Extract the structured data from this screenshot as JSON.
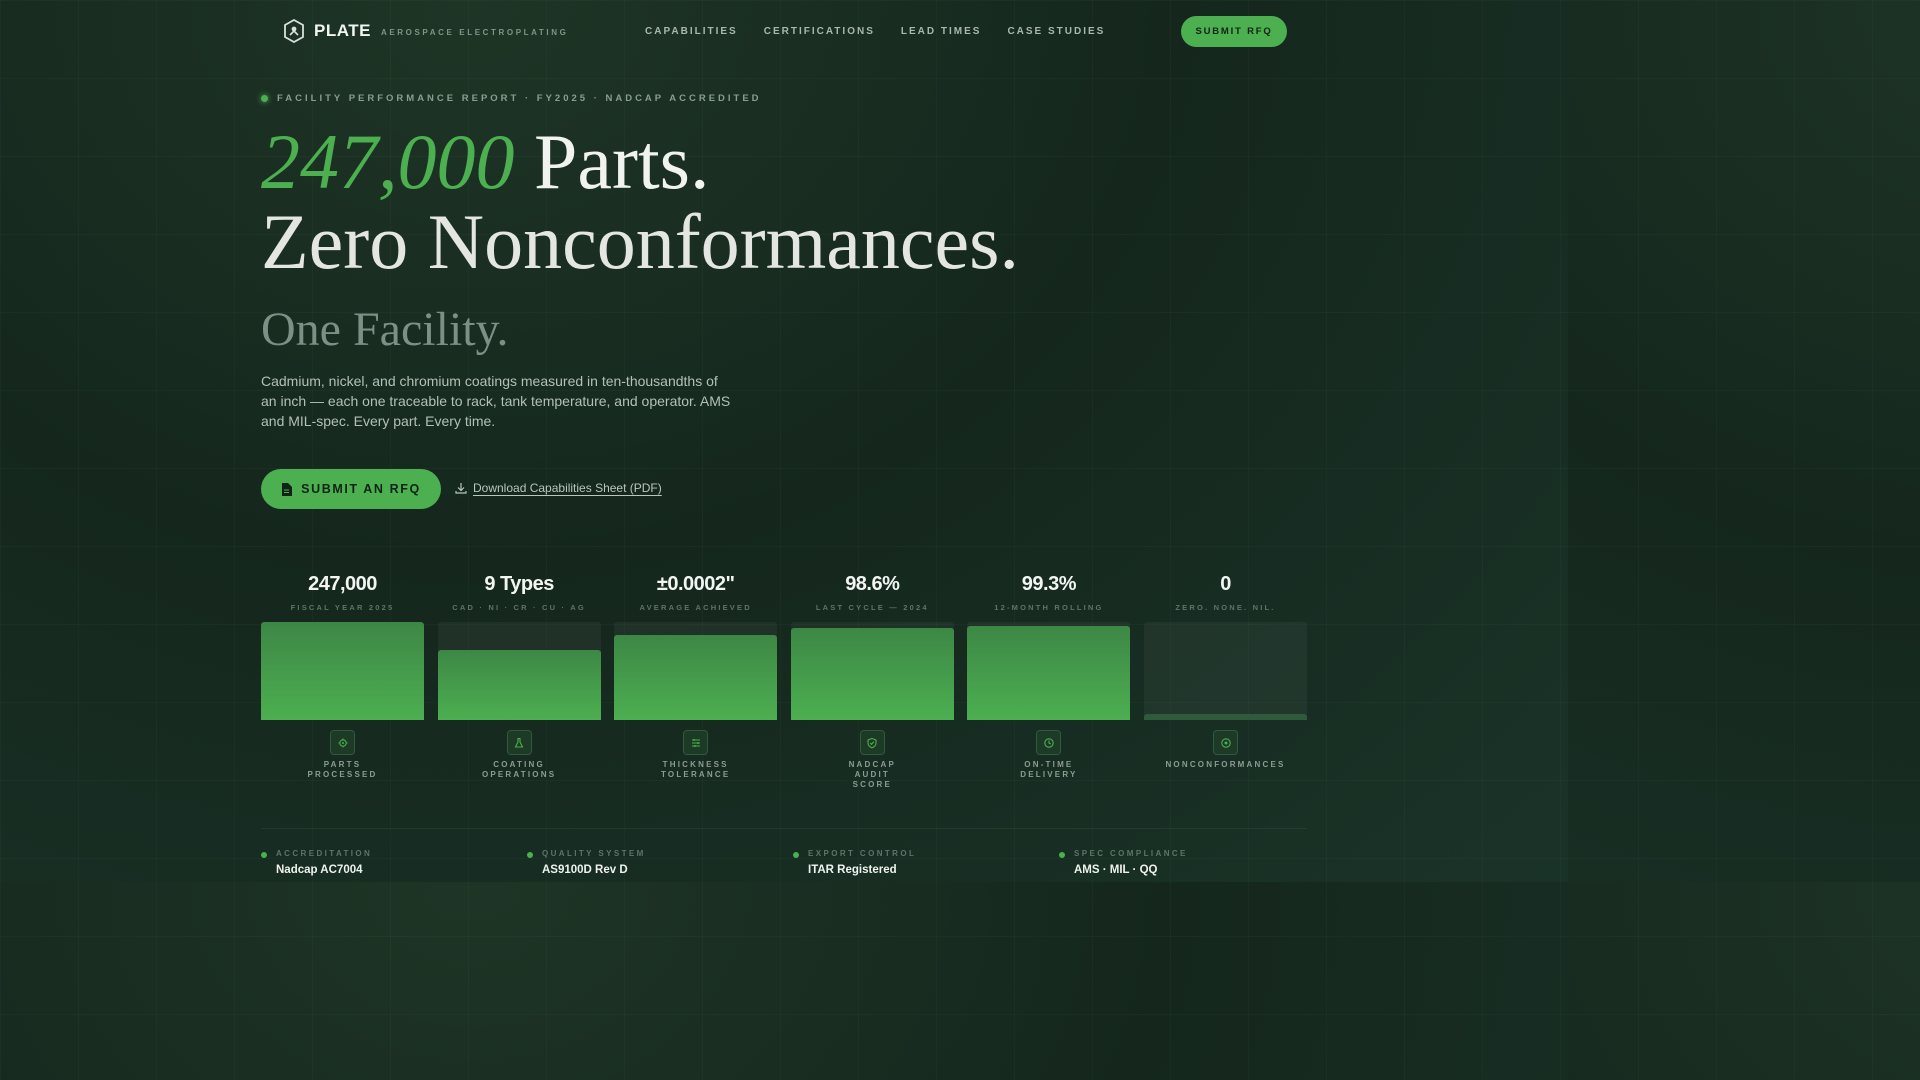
{
  "nav": {
    "brand": "PLATE",
    "tagline": "AEROSPACE ELECTROPLATING",
    "links": [
      "CAPABILITIES",
      "CERTIFICATIONS",
      "LEAD TIMES",
      "CASE STUDIES"
    ],
    "cta": "SUBMIT RFQ"
  },
  "hero": {
    "eyebrow": "FACILITY PERFORMANCE REPORT · FY2025 · NADCAP ACCREDITED",
    "headline_accent": "247,000",
    "headline_rest": " Parts.",
    "headline_line2": "Zero Nonconformances.",
    "subheadline": "One Facility.",
    "lede": "Cadmium, nickel, and chromium coatings measured in ten-thousandths of an inch — each one traceable to rack, tank temperature, and operator. AMS and MIL-spec. Every part. Every time.",
    "cta_primary": "SUBMIT AN RFQ",
    "cta_secondary": "Download Capabilities Sheet (PDF)"
  },
  "stats": [
    {
      "value": "247,000",
      "caption": "FISCAL YEAR 2025",
      "fill": 1.0,
      "icon": "gear-icon",
      "label": [
        "PARTS",
        "PROCESSED"
      ]
    },
    {
      "value": "9 Types",
      "caption": "CAD · NI · CR · CU · AG",
      "fill": 0.71,
      "icon": "flask-icon",
      "label": [
        "COATING",
        "OPERATIONS"
      ]
    },
    {
      "value": "±0.0002\"",
      "caption": "AVERAGE ACHIEVED",
      "fill": 0.87,
      "icon": "sliders-icon",
      "label": [
        "THICKNESS",
        "TOLERANCE"
      ]
    },
    {
      "value": "98.6%",
      "caption": "LAST CYCLE — 2024",
      "fill": 0.94,
      "icon": "shield-check-icon",
      "label": [
        "NADCAP",
        "AUDIT",
        "SCORE"
      ]
    },
    {
      "value": "99.3%",
      "caption": "12-MONTH ROLLING",
      "fill": 0.96,
      "icon": "clock-icon",
      "label": [
        "ON-TIME",
        "DELIVERY"
      ]
    },
    {
      "value": "0",
      "caption": "ZERO. NONE. NIL.",
      "fill": 0.06,
      "icon": "target-icon",
      "label": [
        "NONCONFORMANCES"
      ]
    }
  ],
  "facts": [
    {
      "label": "ACCREDITATION",
      "value": "Nadcap AC7004"
    },
    {
      "label": "QUALITY SYSTEM",
      "value": "AS9100D Rev D"
    },
    {
      "label": "EXPORT CONTROL",
      "value": "ITAR Registered"
    },
    {
      "label": "SPEC COMPLIANCE",
      "value": "AMS · MIL · QQ"
    }
  ],
  "colors": {
    "accent": "#4caf50",
    "background": "#15271d",
    "empty_bar": "#233a2d"
  }
}
